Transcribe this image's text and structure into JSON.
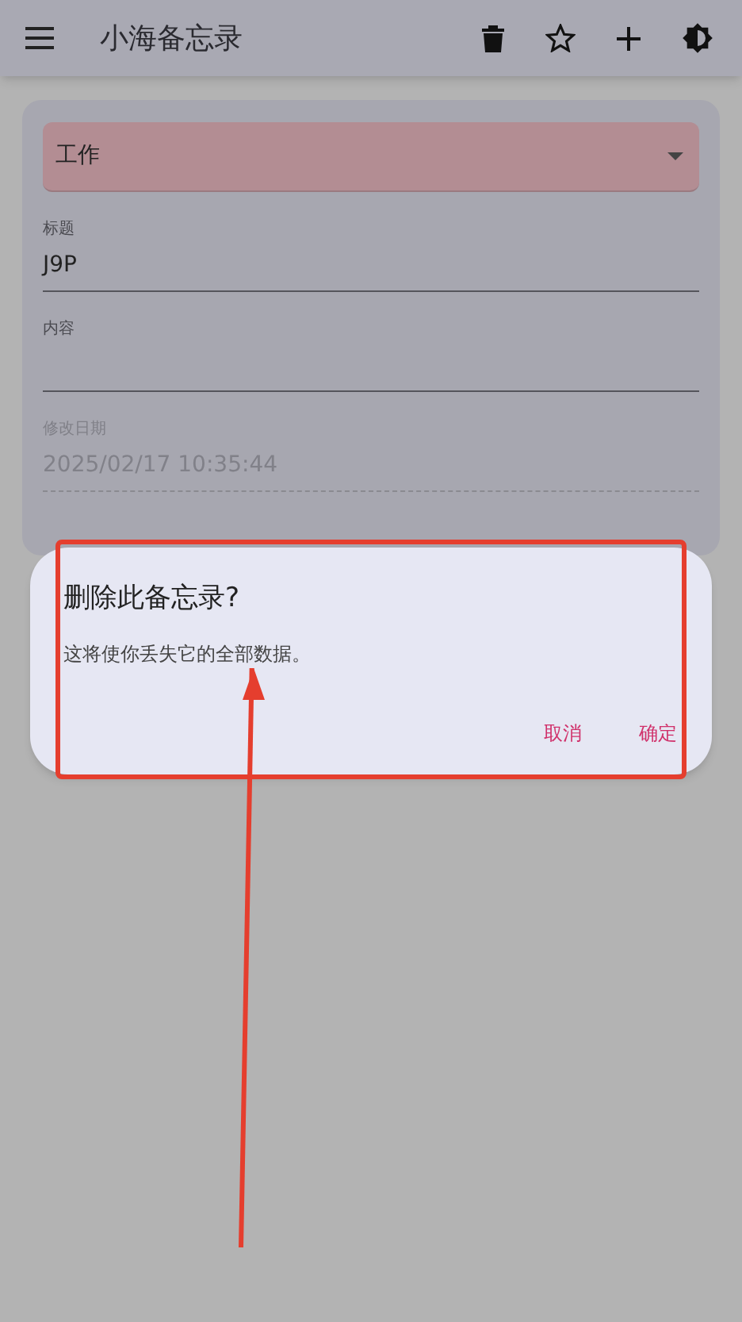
{
  "app_bar": {
    "title": "小海备忘录"
  },
  "form": {
    "category": {
      "value": "工作"
    },
    "fields": [
      {
        "label": "标题",
        "value": "J9P",
        "disabled": false
      },
      {
        "label": "内容",
        "disabled": false
      },
      {
        "label": "修改日期",
        "value": "2025/02/17 10:35:44",
        "disabled": true
      }
    ]
  },
  "dialog": {
    "title": "删除此备忘录?",
    "message": "这将使你丢失它的全部数据。",
    "buttons": [
      "取消",
      "确定"
    ]
  }
}
